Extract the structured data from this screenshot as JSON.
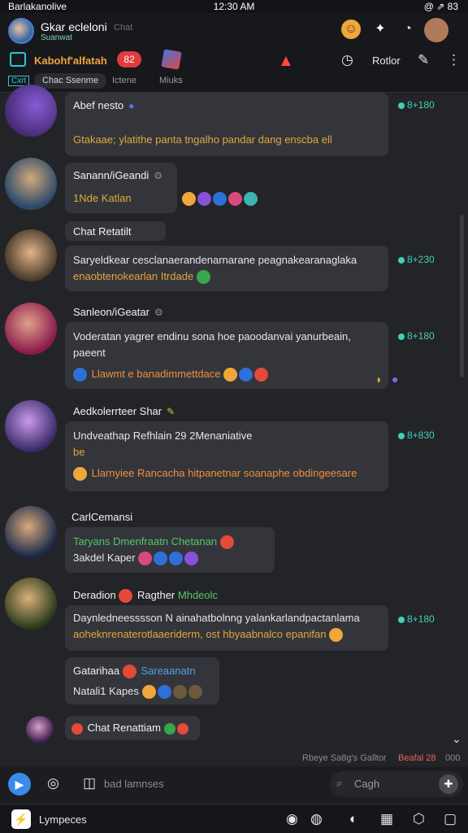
{
  "status_bar": {
    "left": "Barlakanolive",
    "time": "12:30 AM",
    "right": "@ ⇗ 83"
  },
  "header": {
    "title": "Gkar ecleloni",
    "subtitle": "Suanwat",
    "subtitle2": "Chat",
    "brand": "Kabohf'alfatah",
    "badge": "82",
    "right_label": "Rotlor",
    "tabs": [
      "Cxrt",
      "Chac Ssenme",
      "Ictene",
      "Miuks"
    ]
  },
  "messages": [
    {
      "name": "Abef nesto",
      "lines": [
        "Gtakaae; ylatithe panta tngalho pandar dang enscba ell"
      ],
      "meta": "8+180"
    },
    {
      "name": "Sanann/iGeandi",
      "lines": [
        "1Nde Katlan"
      ]
    },
    {
      "name": "Chat Retatilt",
      "lines": [
        "Saryeldkear cesclanaerandenarnarane peagnakearanaglaka",
        "enaobtenokearlan Itrdade"
      ],
      "meta": "8+230"
    },
    {
      "name": "Sanleon/iGeatar",
      "lines": [
        "Voderatan yagrer endinu sona hoe paoodanvai yanurbeain,",
        "paeent",
        "Llawmt e banadimmettdace"
      ],
      "meta": "8+180"
    },
    {
      "name": "Aedkolerrteer Shar",
      "lines": [
        "Undveathap Refhlain 29 2Menaniative",
        "be",
        "Llarnyiee Rancacha hitpanetnar soanaphe obdingeesare"
      ],
      "meta": "8+830"
    },
    {
      "name": "CarlCemansi",
      "lines": [
        "Taryans Dmenfraatn Chetanan",
        "3akdel Kaper"
      ]
    },
    {
      "name": "Deradion",
      "name_b": "Ragther",
      "name_c": "Mhdeolc",
      "lines": [
        "Daynledneesssson N ainahatbolnng yalankarlandpactanlama",
        "aoheknrenaterotlaaeriderm, ost hbyaabnalco epanifan"
      ],
      "meta": "8+180"
    },
    {
      "name": "Gatarihaa",
      "name_b": "Sareaanatn",
      "lines": [
        "Natali1 Kapes"
      ]
    },
    {
      "name": "Chat Renattiam"
    }
  ],
  "footer_meta": {
    "left": "Rbeye Sa8g's Galltor",
    "mid": "Beafal 28",
    "right": "000"
  },
  "composer": {
    "placeholder": "bad lamnses",
    "search": "Cagh"
  },
  "bottom_nav": {
    "label": "Lympeces"
  }
}
